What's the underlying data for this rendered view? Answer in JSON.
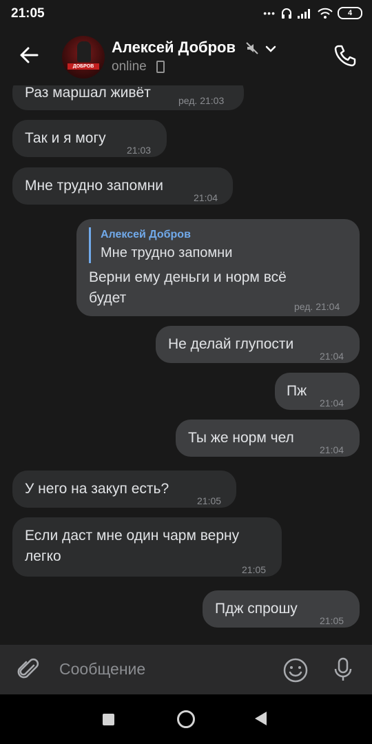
{
  "statusbar": {
    "time": "21:05",
    "battery": "4"
  },
  "header": {
    "contact_name": "Алексей Добров",
    "status": "online",
    "avatar_tag": "ДОБРОВ"
  },
  "messages": [
    {
      "direction": "in",
      "text": "Раз маршал живёт",
      "time": "ред. 21:03"
    },
    {
      "direction": "in",
      "text": "Так и я могу",
      "time": "21:03"
    },
    {
      "direction": "in",
      "text": "Мне трудно запомни",
      "time": "21:04"
    },
    {
      "direction": "out",
      "reply_author": "Алексей Добров",
      "reply_text": "Мне трудно запомни",
      "text_line1": "Верни ему деньги и норм всё",
      "text_line2": "будет",
      "time": "ред. 21:04"
    },
    {
      "direction": "out",
      "text": "Не делай глупости",
      "time": "21:04"
    },
    {
      "direction": "out",
      "text": "Пж",
      "time": "21:04"
    },
    {
      "direction": "out",
      "text": "Ты же норм чел",
      "time": "21:04"
    },
    {
      "direction": "in",
      "text": "У него на закуп есть?",
      "time": "21:05"
    },
    {
      "direction": "in",
      "text_line1": "Если даст мне один чарм верну",
      "text_line2": "легко",
      "time": "21:05"
    },
    {
      "direction": "out",
      "text": "Пдж спрошу",
      "time": "21:05"
    }
  ],
  "composer": {
    "placeholder": "Сообщение"
  },
  "icons": {
    "back": "arrow-left-icon",
    "mute": "speaker-muted-icon",
    "chevron": "chevron-down-icon",
    "call": "phone-icon",
    "attach": "paperclip-icon",
    "emoji": "smile-icon",
    "mic": "microphone-icon"
  },
  "colors": {
    "background": "#191919",
    "bubble_in": "#2c2d2e",
    "bubble_out": "#3e3f41",
    "accent": "#71aaeb"
  }
}
